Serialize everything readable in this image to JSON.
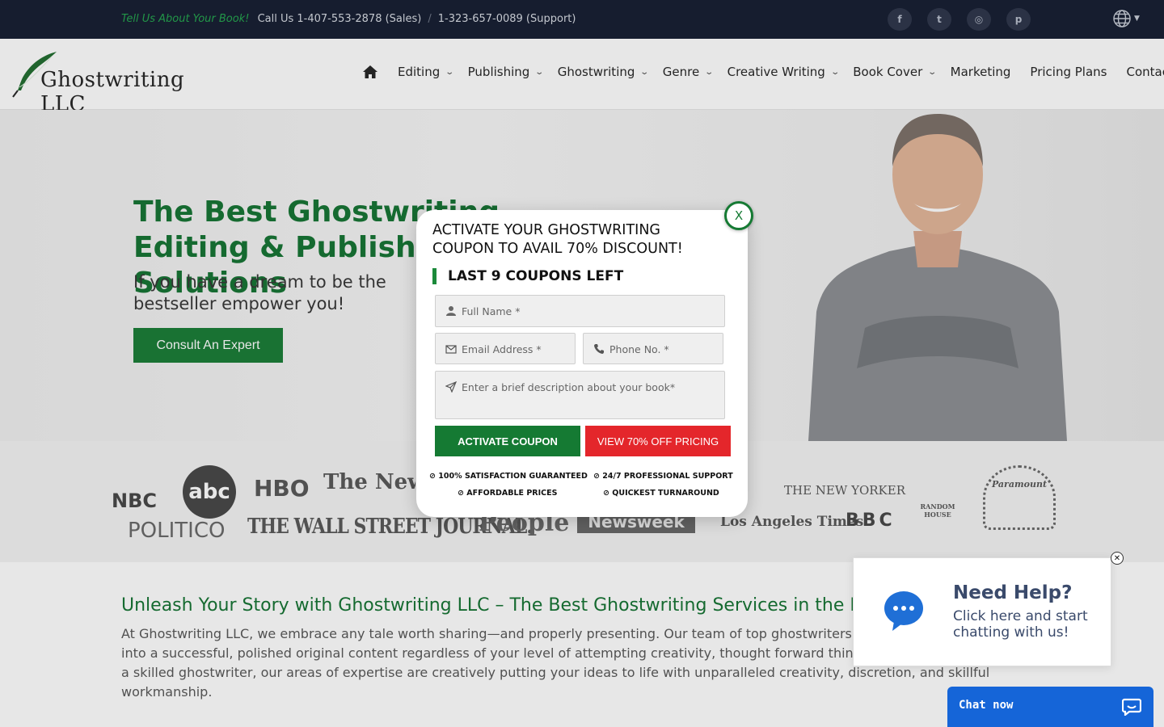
{
  "topbar": {
    "tagline": "Tell Us About Your Book!",
    "call_prefix": "Call Us",
    "phone_sales": "1-407-553-2878 (Sales)",
    "separator": "/",
    "phone_support": "1-323-657-0089 (Support)",
    "socials": [
      {
        "icon": "facebook-icon",
        "glyph": "f"
      },
      {
        "icon": "twitter-icon",
        "glyph": "t"
      },
      {
        "icon": "instagram-icon",
        "glyph": "◎"
      },
      {
        "icon": "pinterest-icon",
        "glyph": "p"
      }
    ]
  },
  "brand": {
    "name": "Ghostwriting LLC"
  },
  "nav": {
    "items": [
      {
        "label": "Editing",
        "dropdown": true
      },
      {
        "label": "Publishing",
        "dropdown": true
      },
      {
        "label": "Ghostwriting",
        "dropdown": true
      },
      {
        "label": "Genre",
        "dropdown": true
      },
      {
        "label": "Creative Writing",
        "dropdown": true
      },
      {
        "label": "Book Cover",
        "dropdown": true
      },
      {
        "label": "Marketing",
        "dropdown": false
      },
      {
        "label": "Pricing Plans",
        "dropdown": false
      },
      {
        "label": "Contact Us",
        "dropdown": false
      }
    ]
  },
  "hero": {
    "title": "The Best Ghostwriting Editing & Publishing Solutions",
    "subtitle": "If you have a dream to be the bestseller empower you!",
    "cta": "Consult An Expert"
  },
  "logos": [
    "NBC",
    "abc",
    "HBO",
    "The New York Times",
    "POLITICO",
    "THE WALL STREET JOURNAL.",
    "People",
    "Newsweek",
    "THE NEW YORKER",
    "RANDOM HOUSE",
    "Los Angeles Times",
    "BBC",
    "Paramount"
  ],
  "content": {
    "heading": "Unleash Your Story with Ghostwriting LLC – The Best Ghostwriting Services in the Industry",
    "body": "At Ghostwriting LLC, we embrace any tale worth sharing—and properly presenting. Our team of top ghostwriters for hire can turn your idea into a successful, polished original content regardless of your level of attempting creativity, thought forward thinking, and message. Being a skilled ghostwriter, our areas of expertise are creatively putting your ideas to life with unparalleled creativity, discretion, and skillful workmanship."
  },
  "modal": {
    "close_label": "X",
    "title": "ACTIVATE YOUR GHOSTWRITING COUPON TO AVAIL 70% DISCOUNT!",
    "coupons_left": "LAST 9 COUPONS LEFT",
    "fields": {
      "full_name": "Full Name *",
      "email": "Email Address *",
      "phone": "Phone No. *",
      "description": "Enter a brief description about your book*"
    },
    "activate_button": "ACTIVATE COUPON",
    "view_button": "VIEW 70% OFF PRICING",
    "features": [
      "100% SATISFACTION GUARANTEED",
      "24/7 PROFESSIONAL SUPPORT",
      "AFFORDABLE PRICES",
      "QUICKEST TURNAROUND"
    ]
  },
  "help_widget": {
    "close_label": "✕",
    "title": "Need Help?",
    "text": "Click here and start chatting with us!"
  },
  "chat": {
    "label": "Chat now"
  },
  "colors": {
    "brand_green": "#157a33",
    "accent_red": "#e4262b",
    "topbar": "#121a2e",
    "chat_blue": "#1565d8"
  }
}
